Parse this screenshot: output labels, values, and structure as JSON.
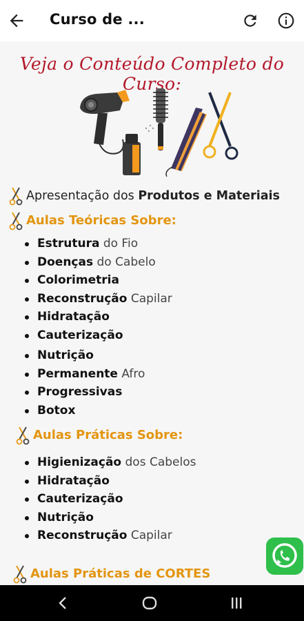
{
  "app_bar": {
    "title": "Curso de ...",
    "back_icon": "arrow-back-icon",
    "refresh_icon": "refresh-icon",
    "info_icon": "info-icon"
  },
  "banner": {
    "cursive_title": "Veja o Conteúdo Completo do Curso:"
  },
  "intro_line": {
    "prefix": "Apresentação dos ",
    "bold": "Produtos e Materiais"
  },
  "sections": [
    {
      "heading": "Aulas Teóricas Sobre:",
      "items": [
        {
          "bold": "Estrutura",
          "rest": " do Fio"
        },
        {
          "bold": "Doenças",
          "rest": " do Cabelo"
        },
        {
          "bold": "Colorimetria",
          "rest": ""
        },
        {
          "bold": "Reconstrução",
          "rest": " Capilar"
        },
        {
          "bold": "Hidratação",
          "rest": ""
        },
        {
          "bold": "Cauterização",
          "rest": ""
        },
        {
          "bold": "Nutrição",
          "rest": ""
        },
        {
          "bold": "Permanente",
          "rest": " Afro"
        },
        {
          "bold": "Progressivas",
          "rest": ""
        },
        {
          "bold": "Botox",
          "rest": ""
        }
      ]
    },
    {
      "heading": "Aulas Práticas Sobre:",
      "items": [
        {
          "bold": "Higienização",
          "rest": " dos Cabelos"
        },
        {
          "bold": "Hidratação",
          "rest": ""
        },
        {
          "bold": "Cauterização",
          "rest": ""
        },
        {
          "bold": "Nutrição",
          "rest": ""
        },
        {
          "bold": "Reconstrução",
          "rest": " Capilar"
        }
      ]
    },
    {
      "heading": "Aulas Práticas de CORTES",
      "items": []
    }
  ],
  "colors": {
    "cursive_red": "#b3182a",
    "heading_orange": "#e39510",
    "whatsapp_green": "#2fbf4b",
    "content_bg": "#f6f6f6"
  },
  "floating": {
    "whatsapp_icon": "whatsapp-icon"
  },
  "nav_bar": {
    "icons": [
      "back-nav-icon",
      "home-nav-icon",
      "recents-nav-icon"
    ]
  }
}
